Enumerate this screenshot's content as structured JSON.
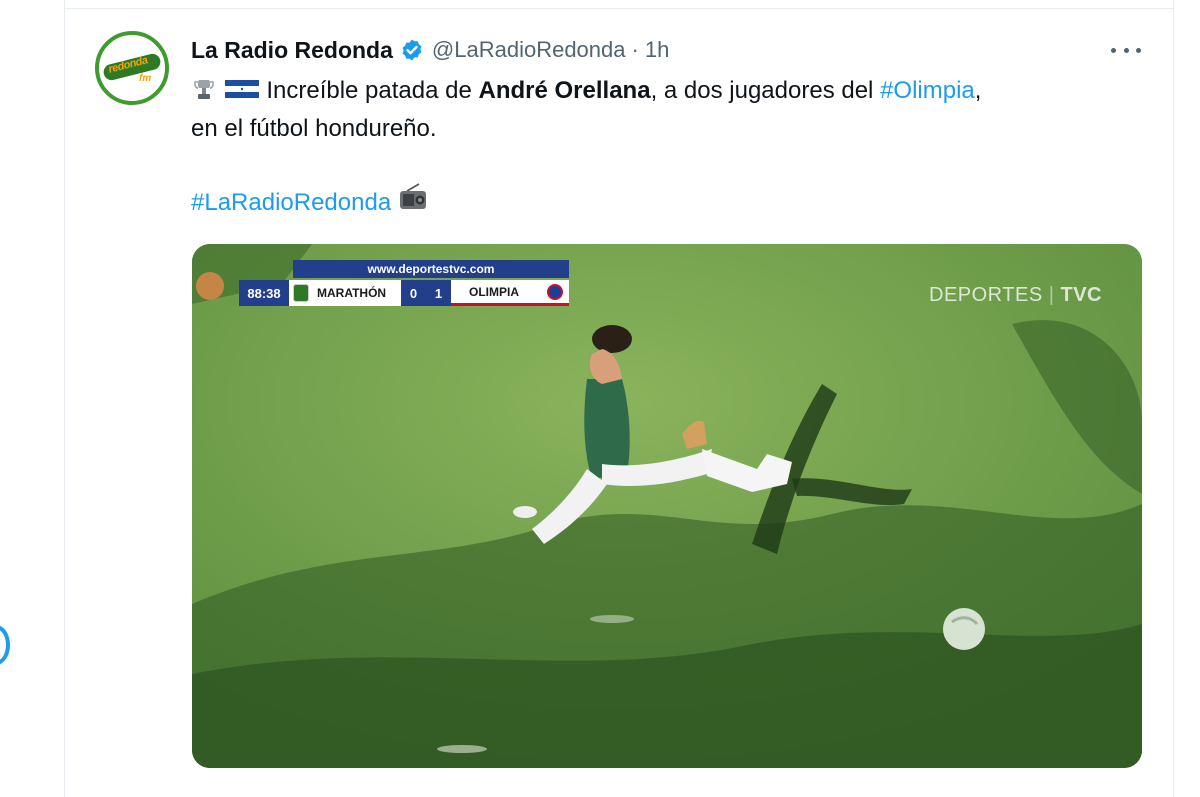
{
  "tweet": {
    "display_name": "La Radio Redonda",
    "handle": "@LaRadioRedonda",
    "separator": "·",
    "time": "1h",
    "text": {
      "part1": " Increíble patada de ",
      "bold_name": "André Orellana",
      "part2": ", a dos jugadores del ",
      "hashtag1": "#Olimpia",
      "part3": ",",
      "line2": "en el fútbol hondureño."
    },
    "hashtag2": "#LaRadioRedonda",
    "avatar": {
      "logo_text": "redonda",
      "logo_suffix": "fm"
    },
    "icons": [
      "verified-icon",
      "more-icon",
      "trophy-icon",
      "honduras-flag-icon",
      "radio-icon"
    ]
  },
  "media": {
    "scoreboard": {
      "url": "www.deportestvc.com",
      "clock": "88:38",
      "home_team": "MARATHÓN",
      "home_score": "0",
      "away_score": "1",
      "away_team": "OLIMPIA"
    },
    "broadcaster": {
      "part1": "DEPORTES",
      "part2": "TVC"
    }
  },
  "colors": {
    "link": "#1d9bf0",
    "text": "#0f1419",
    "secondary": "#536471",
    "scoreboard_blue": "#233e8b"
  }
}
